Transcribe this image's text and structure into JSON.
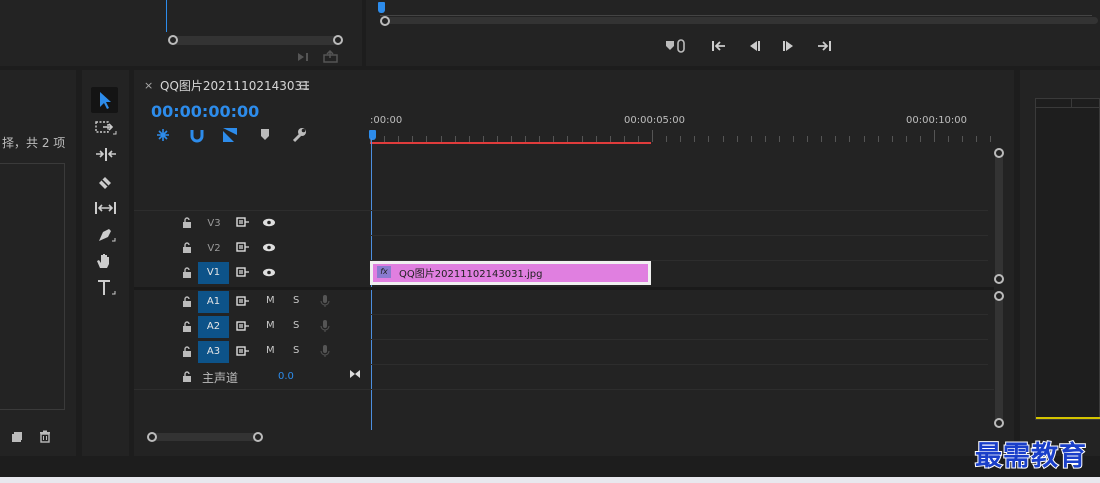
{
  "timeline": {
    "sequence_name": "QQ图片20211102143031",
    "timecode": "00:00:00:00",
    "ruler_labels": [
      ":00:00",
      "00:00:05:00",
      "00:00:10:00"
    ],
    "tracks": {
      "video": [
        "V3",
        "V2",
        "V1"
      ],
      "audio": [
        "A1",
        "A2",
        "A3"
      ],
      "mute_label": "M",
      "solo_label": "S"
    },
    "master": {
      "label": "主声道",
      "value": "0.0"
    },
    "clip": {
      "name": "QQ图片20211102143031.jpg",
      "fx": "fx",
      "color": "#e07fe0"
    }
  },
  "project_panel": {
    "selection_text": "择，共 2 项"
  },
  "watermark": "最需教育",
  "colors": {
    "accent_blue": "#2d8ceb",
    "playhead": "#4c8fe0",
    "in_out_red": "#e03c3c",
    "track_active": "#0d5389"
  }
}
